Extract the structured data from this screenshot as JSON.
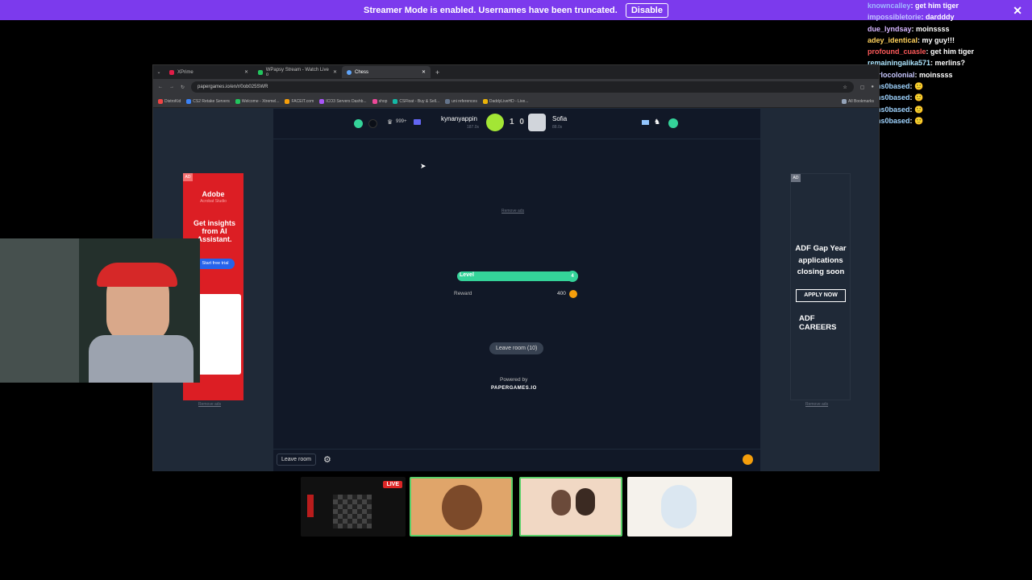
{
  "banner": {
    "text": "Streamer Mode is enabled. Usernames have been truncated.",
    "button": "Disable",
    "close": "✕"
  },
  "chat": [
    {
      "user": "knowncalley",
      "color": "#a0b8ff",
      "text": "get him tiger"
    },
    {
      "user": "impossibletorie",
      "color": "#c0c0ff",
      "text": "dardddy"
    },
    {
      "user": "due_lyndsay",
      "color": "#d6b6ff",
      "text": "moinssss"
    },
    {
      "user": "adey_identical",
      "color": "#ffd15c",
      "text": "my guy!!!"
    },
    {
      "user": "profound_cuasle",
      "color": "#ff5a5a",
      "text": "get him tiger"
    },
    {
      "user": "remainingalika571",
      "color": "#aee6ff",
      "text": "merlins?"
    },
    {
      "user": "marlocolonial",
      "color": "#c8c8ff",
      "text": "moinssss"
    },
    {
      "user": "toms0based",
      "color": "#9fd4ff",
      "text": "🙂"
    },
    {
      "user": "toms0based",
      "color": "#9fd4ff",
      "text": "🙂"
    },
    {
      "user": "toms0based",
      "color": "#9fd4ff",
      "text": "🙂"
    },
    {
      "user": "toms0based",
      "color": "#9fd4ff",
      "text": "🙂"
    }
  ],
  "browser": {
    "tabs": [
      {
        "label": "XPrime",
        "active": false
      },
      {
        "label": "WPapsy Stream - Watch Live o",
        "active": false
      },
      {
        "label": "Chess",
        "active": true
      }
    ],
    "new_tab": "+",
    "url": "papergames.io/en/r/0ob025SWR",
    "bookmarks": [
      "DistroKid",
      "CS2 Retake Servers",
      "Welcome - Xtremel...",
      "FACEIT.com",
      "ICO3 Servers Dashb...",
      "shop",
      "CSFloat - Buy & Sell...",
      "uni references",
      "DaddyLiveHD - Live...",
      "All Bookmarks"
    ]
  },
  "game": {
    "player1": {
      "name": "kynanyappin",
      "sub": "187.0s",
      "rating": "999+"
    },
    "score": "1 0",
    "player2": {
      "name": "Sofia",
      "sub": "88.0s"
    },
    "remove_ads": "Remove ads",
    "level": {
      "label": "Level",
      "value": "4",
      "progress": 0.95
    },
    "reward": {
      "label": "Reward",
      "value": "400"
    },
    "leave_room_center": "Leave room (10)",
    "powered_by": "Powered by",
    "brand": "PAPERGAMES.IO",
    "leave_room_bottom": "Leave room"
  },
  "ad_left": {
    "brand": "Adobe",
    "subtitle": "Acrobat Studio",
    "headline": "Get insights from AI Assistant.",
    "cta": "Start free trial",
    "remove": "Remove ads"
  },
  "ad_right": {
    "headline": "ADF Gap Year applications closing soon",
    "cta": "APPLY NOW",
    "brand": "ADF CAREERS",
    "remove": "Remove ads"
  },
  "taskbar": {
    "live_badge": "LIVE"
  }
}
